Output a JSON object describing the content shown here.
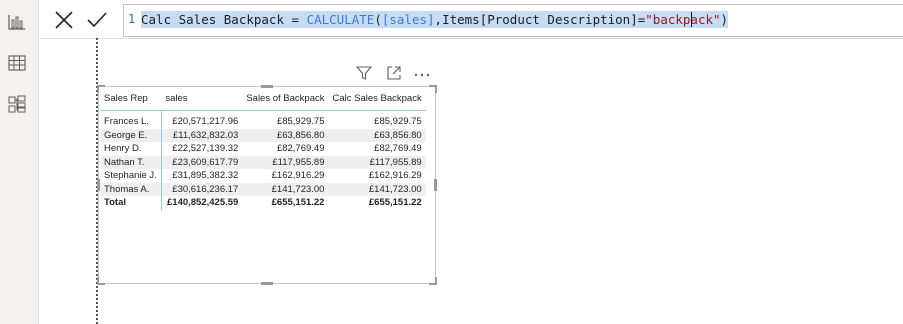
{
  "formula": {
    "line_number": "1",
    "measure_name": "Calc Sales Backpack",
    "operator": " = ",
    "function": "CALCULATE",
    "open_paren": "(",
    "measure_ref": "[sales]",
    "comma": ",",
    "column_ref": "Items[Product Description]",
    "equals": "=",
    "string_value": "\"backpack\"",
    "close_paren": ")"
  },
  "table": {
    "columns": [
      "Sales Rep",
      "sales",
      "Sales of Backpack",
      "Calc Sales Backpack"
    ],
    "rows": [
      [
        "Frances L.",
        "£20,571,217.96",
        "£85,929.75",
        "£85,929.75"
      ],
      [
        "George E.",
        "£11,632,832.03",
        "£63,856.80",
        "£63,856.80"
      ],
      [
        "Henry D.",
        "£22,527,139.32",
        "£82,769.49",
        "£82,769.49"
      ],
      [
        "Nathan T.",
        "£23,609,617.79",
        "£117,955.89",
        "£117,955.89"
      ],
      [
        "Stephanie J.",
        "£31,895,382.32",
        "£162,916.29",
        "£162,916.29"
      ],
      [
        "Thomas A.",
        "£30,616,236.17",
        "£141,723.00",
        "£141,723.00"
      ]
    ],
    "total": [
      "Total",
      "£140,852,425.59",
      "£655,151.22",
      "£655,151.22"
    ]
  },
  "icons": {
    "rail": [
      "report-view-icon",
      "table-view-icon",
      "model-view-icon"
    ],
    "visual_header": [
      "filter-icon",
      "focus-mode-icon",
      "more-options-icon"
    ],
    "formula_bar": [
      "cancel-icon",
      "commit-icon"
    ]
  }
}
